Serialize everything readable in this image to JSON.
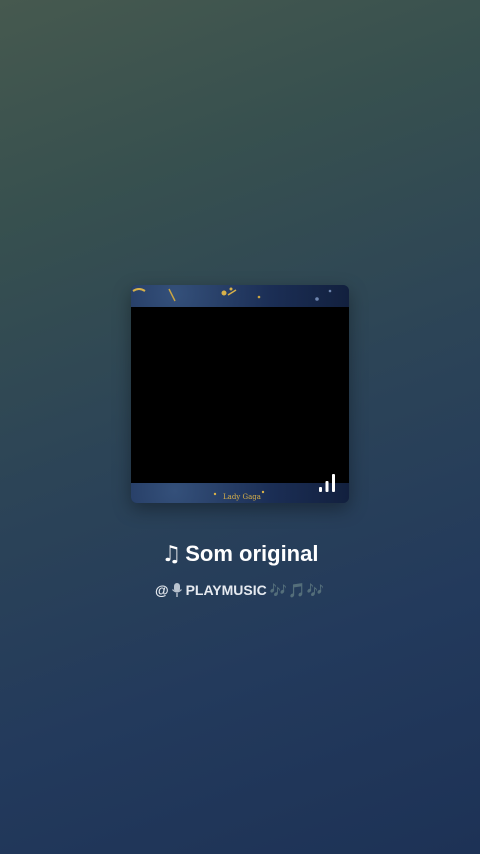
{
  "sound": {
    "note_icon": "♫",
    "title": "Som original",
    "author_prefix": "@",
    "author_mic_icon": "microphone-icon",
    "author_name": "PLAYMUSIC",
    "author_suffix": "🎶🎵🎶"
  },
  "artwork": {
    "cover_text": "Lady Gaga",
    "signal_icon": "signal-bars-icon"
  },
  "colors": {
    "bg_top": "#46594f",
    "bg_bottom": "#1d3256",
    "cover_accent": "#d8b14a"
  }
}
